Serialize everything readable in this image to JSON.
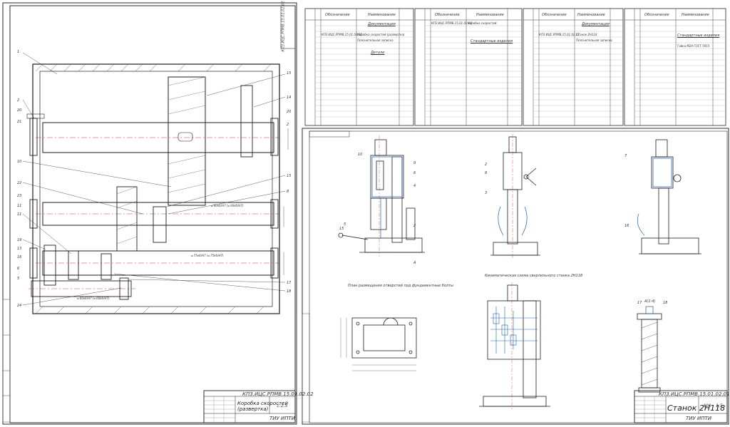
{
  "sheet_left": {
    "doc_code": "КПЗ.ИЦС.РПМВ.15.01.02.02",
    "side_doc_code": "КПЗ.ИЦС.РПМВ.15.01.02.02",
    "title_line1": "Коробка скоростей",
    "title_line2": "(развертка)",
    "sheet_scale": "1:2,5",
    "organization": "ТИУ ИПТИ"
  },
  "sheet_right": {
    "doc_code": "КПЗ.ИЦС.РПМВ.15.01.02.01",
    "title": "Станок 2Н118",
    "mass": "400",
    "scale": "1:5",
    "organization": "ТИУ ИПТИ",
    "caption_holes": "План размещения отверстий под фундаментные болты",
    "caption_kinematic": "Кинематическая схема сверлильного станка 2Н118",
    "section_label": "А(1:4)"
  },
  "spec_tables": [
    {
      "headers": [
        "Обозначение",
        "Наименование",
        "Примечание"
      ],
      "sections": [
        "Документация",
        "Детали"
      ],
      "first_row": "КПЗ.ИЦС.РПМВ.15.01.02.02",
      "first_name": "Коробка скоростей (развертка)",
      "second_name": "Пояснительная записка"
    },
    {
      "headers": [
        "Обозначение",
        "Наименование",
        "Примечание"
      ],
      "sections": [
        "Стандартные изделия"
      ],
      "first_row": "КПЗ.ИЦС.РПМВ.15.01.02.02",
      "first_name": "Коробка скоростей"
    },
    {
      "headers": [
        "Обозначение",
        "Наименование",
        "Примечание"
      ],
      "sections": [
        "Документация"
      ],
      "first_row": "КПЗ.ИЦС.РПМВ.15.01.02.01",
      "first_name": "Станок 2Н118",
      "second_name": "Пояснительная записка"
    },
    {
      "headers": [
        "Обозначение",
        "Наименование",
        "Примечание"
      ],
      "sections": [
        "Стандартные изделия"
      ],
      "first_name": "Гайка М24 ГОСТ 5915"
    }
  ],
  "colors": {
    "line": "#1f1f1f",
    "hatch": "#444444",
    "accent_blue": "#1a5fb0",
    "center_red": "#c23a2a",
    "frame": "#2b2b2b"
  }
}
